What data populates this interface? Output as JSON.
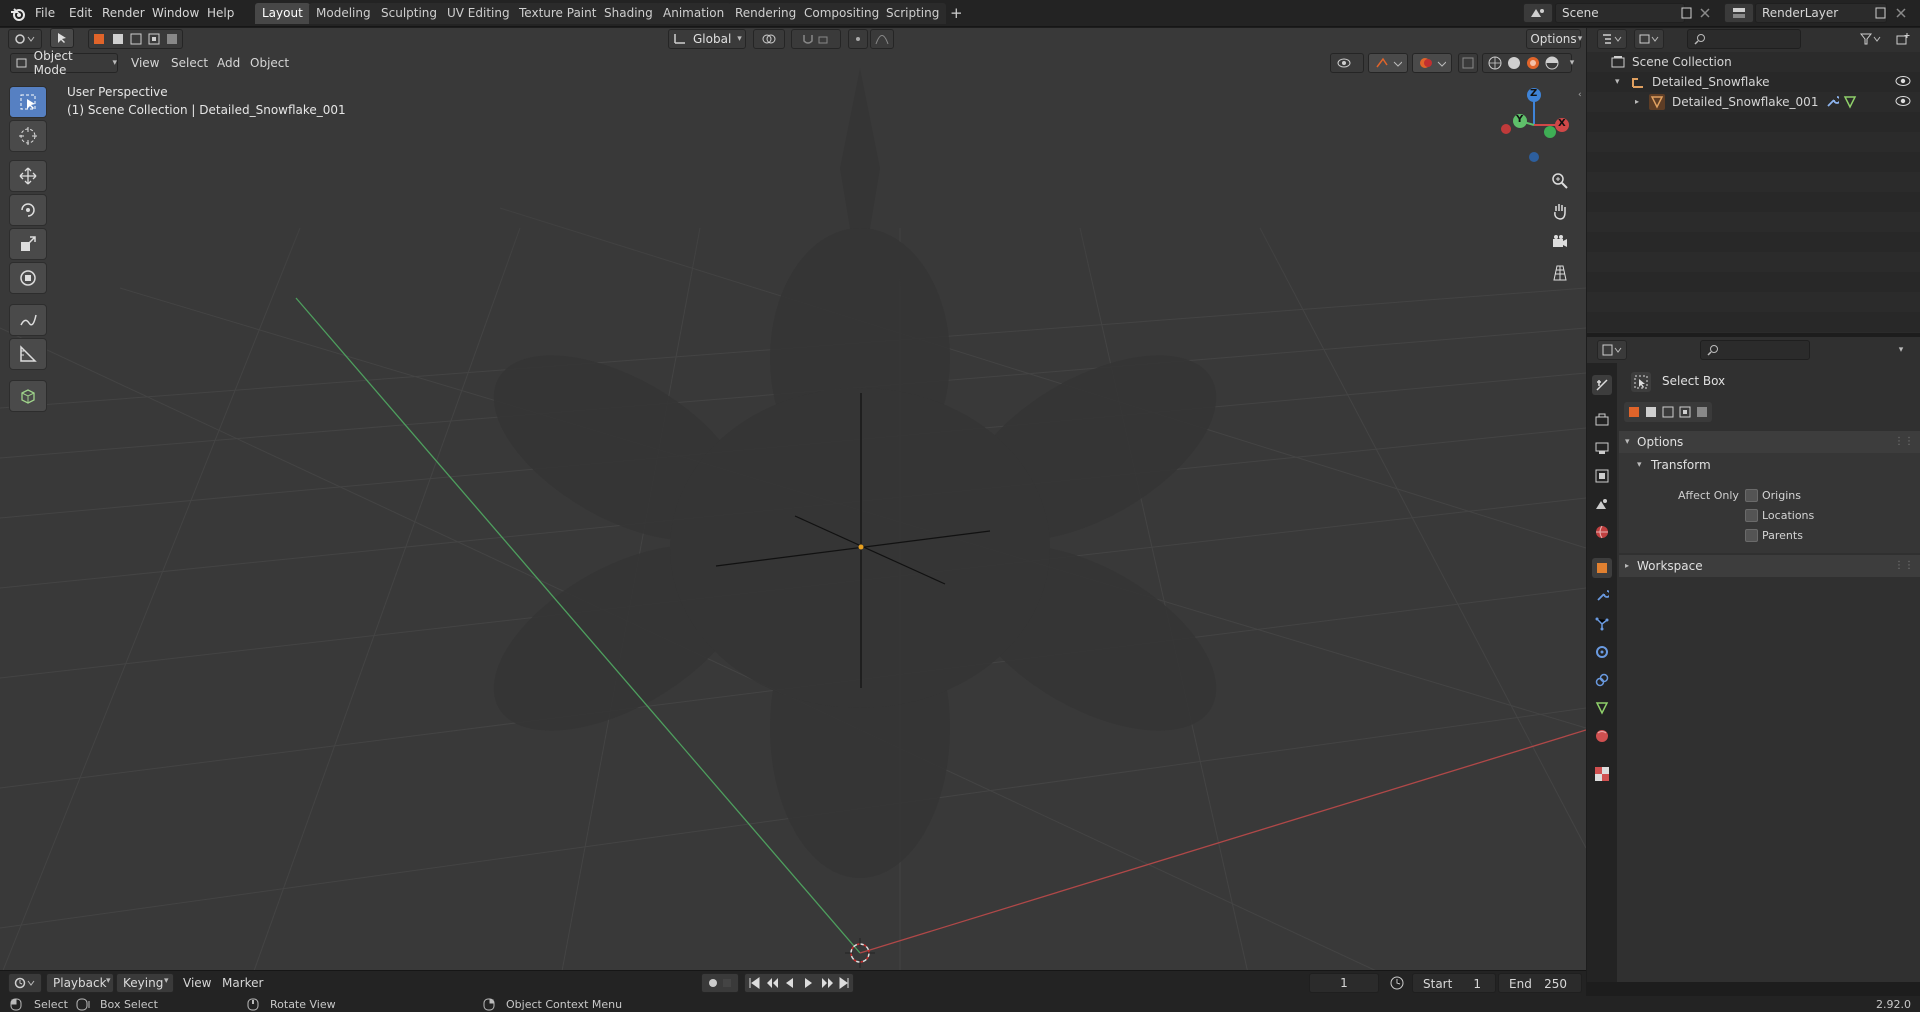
{
  "topbar": {
    "menus": [
      "File",
      "Edit",
      "Render",
      "Window",
      "Help"
    ],
    "workspaces": [
      "Layout",
      "Modeling",
      "Sculpting",
      "UV Editing",
      "Texture Paint",
      "Shading",
      "Animation",
      "Rendering",
      "Compositing",
      "Scripting"
    ],
    "active_workspace": "Layout",
    "add_workspace": "+",
    "scene_name": "Scene",
    "view_layer": "RenderLayer"
  },
  "viewport_header": {
    "mode": "Object Mode",
    "menus": [
      "View",
      "Select",
      "Add",
      "Object"
    ],
    "transform_orientation": "Global",
    "options_label": "Options"
  },
  "viewport": {
    "view_name": "User Perspective",
    "collection_info": "(1) Scene Collection | Detailed_Snowflake_001",
    "gizmo": {
      "x": "X",
      "y": "Y",
      "z": "Z"
    }
  },
  "outliner": {
    "root": "Scene Collection",
    "collection": "Detailed_Snowflake",
    "object": "Detailed_Snowflake_001"
  },
  "properties": {
    "tool_name": "Select Box",
    "panels": {
      "options": "Options",
      "transform": "Transform",
      "affect_only": "Affect Only",
      "origins": "Origins",
      "locations": "Locations",
      "parents": "Parents",
      "workspace": "Workspace"
    }
  },
  "timeline": {
    "menus": [
      "Playback",
      "Keying",
      "View",
      "Marker"
    ],
    "current_frame": "1",
    "start_label": "Start",
    "start": "1",
    "end_label": "End",
    "end": "250"
  },
  "statusbar": {
    "select": "Select",
    "box_select": "Box Select",
    "rotate_view": "Rotate View",
    "context_menu": "Object Context Menu",
    "version": "2.92.0"
  },
  "colors": {
    "accent": "#e0642a",
    "active_tool": "#5680c2",
    "axis_x": "#d04848",
    "axis_y": "#5fc06a",
    "axis_z": "#3f84d8"
  }
}
